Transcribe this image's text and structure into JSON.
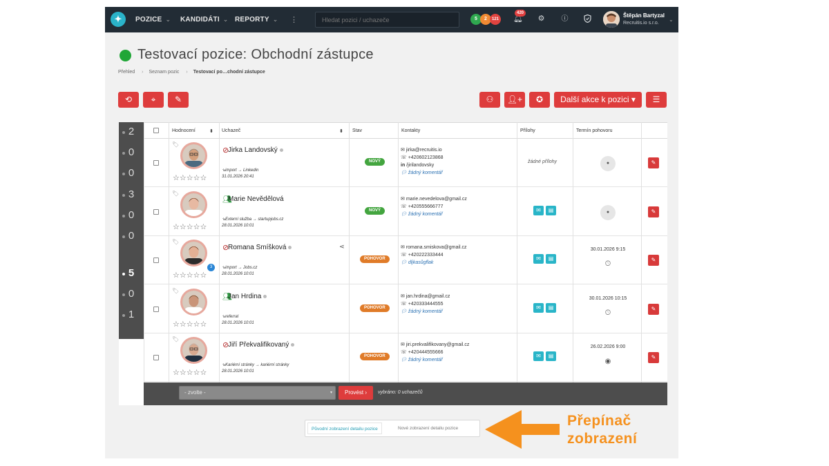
{
  "topbar": {
    "logo_glyph": "✦",
    "nav": [
      "POZICE",
      "KANDIDÁTI",
      "REPORTY"
    ],
    "more_glyph": "⋮",
    "search_placeholder": "Hledat pozici / uchazeče",
    "counters": [
      {
        "value": "5",
        "color": "#2fa84f"
      },
      {
        "value": "2",
        "color": "#f08a33"
      },
      {
        "value": "121",
        "color": "#e0433f"
      }
    ],
    "notifications_badge": "420",
    "user_name": "Štěpán Bartyzal",
    "user_company": "Recruitis.io s.r.o."
  },
  "header": {
    "title": "Testovací pozice: Obchodní zástupce",
    "breadcrumb": [
      "Přehled",
      "Seznam pozic",
      "Testovací po…chodní zástupce"
    ]
  },
  "actions": {
    "more_label": "Další akce k pozici ▾"
  },
  "score_column": [
    "2",
    "0",
    "0",
    "3",
    "0",
    "0",
    "5",
    "0",
    "1"
  ],
  "score_active_index": 6,
  "table": {
    "headers": {
      "rating": "Hodnocení",
      "candidate": "Uchazeč",
      "status": "Stav",
      "contacts": "Kontakty",
      "attachments": "Přílohy",
      "interview": "Termín pohovoru"
    },
    "rows": [
      {
        "name": "Jirka Landovský",
        "icon": "blocked-icon",
        "source": "import → Linkedin",
        "date": "31.01.2026 20:41",
        "status": "NOVÝ",
        "status_type": "novy",
        "email": "jirka@recruitis.io",
        "phone": "+420602123868",
        "linkedin": "/jirilandovsky",
        "comment": "žádný komentář",
        "attachments": "žádné přílohy",
        "interview_date": "",
        "interview_icon": "dot-icon"
      },
      {
        "name": "Marie Nevědělová",
        "icon": "people-icon",
        "source": "Externí služba → startupjobs.cz",
        "date": "28.01.2026 10:01",
        "status": "NOVÝ",
        "status_type": "novy",
        "email": "marie.nevedelova@gmail.cz",
        "phone": "+420555666777",
        "comment": "žádný komentář",
        "attachments": "",
        "interview_date": "",
        "interview_icon": "dot-icon"
      },
      {
        "name": "Romana Smíšková",
        "icon": "blocked-icon",
        "source": "import → Jobs.cz",
        "date": "28.01.2026 10:01",
        "status": "POHOVOR",
        "status_type": "pohovor",
        "email": "romana.smiskova@gmail.cz",
        "phone": "+420222333444",
        "comment": "dljkasůgflak",
        "attachments": "",
        "interview_date": "30.01.2026 9:15",
        "interview_icon": "clock-icon",
        "avatar_badge": "3"
      },
      {
        "name": "Jan Hrdina",
        "icon": "people-icon",
        "source": "referral",
        "date": "28.01.2026 10:01",
        "status": "POHOVOR",
        "status_type": "pohovor",
        "email": "jan.hrdina@gmail.cz",
        "phone": "+420333444555",
        "comment": "žádný komentář",
        "attachments": "",
        "interview_date": "30.01.2026 10:15",
        "interview_icon": "clock-icon"
      },
      {
        "name": "Jiří Překvalifikovaný",
        "icon": "blocked-icon",
        "source": "Kariérní stránky → kariérní stránky",
        "date": "28.01.2026 10:01",
        "status": "POHOVOR",
        "status_type": "pohovor",
        "email": "jiri.prekvalifikovany@gmail.cz",
        "phone": "+420444555666",
        "comment": "žádný komentář",
        "attachments": "",
        "interview_date": "26.02.2026 9:00",
        "interview_icon": "webcam-icon"
      }
    ],
    "footer": {
      "select_placeholder": "- zvolte -",
      "run_label": "Provést ›",
      "selected_text": "vybráno: 0 uchazečů"
    }
  },
  "view_switch": {
    "original": "Původní zobrazení detailu pozice",
    "new": "Nové zobrazení detailu pozice"
  },
  "annotation": {
    "line1": "Přepínač",
    "line2": "zobrazení",
    "color": "#f5911e"
  }
}
